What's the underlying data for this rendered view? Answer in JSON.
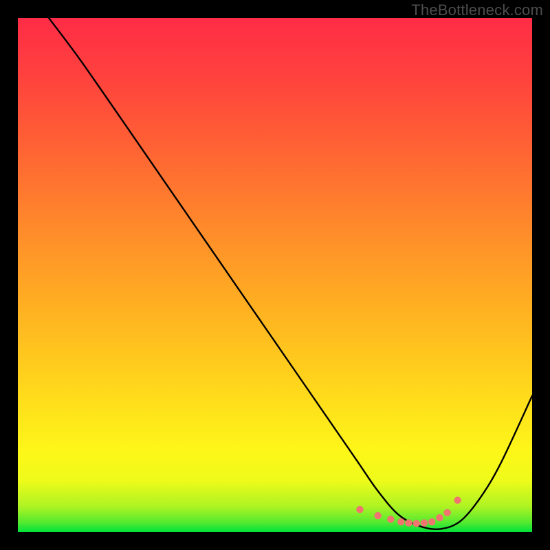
{
  "watermark": "TheBottleneck.com",
  "chart_data": {
    "type": "line",
    "title": "",
    "xlabel": "",
    "ylabel": "",
    "xlim": [
      0,
      100
    ],
    "ylim": [
      0,
      100
    ],
    "grid": false,
    "background_gradient": {
      "stops": [
        {
          "offset": 0.0,
          "color": "#00e23a"
        },
        {
          "offset": 0.02,
          "color": "#58ea2f"
        },
        {
          "offset": 0.05,
          "color": "#aef323"
        },
        {
          "offset": 0.1,
          "color": "#eefb1a"
        },
        {
          "offset": 0.16,
          "color": "#fef619"
        },
        {
          "offset": 0.3,
          "color": "#ffd21c"
        },
        {
          "offset": 0.45,
          "color": "#ffad22"
        },
        {
          "offset": 0.6,
          "color": "#ff882b"
        },
        {
          "offset": 0.75,
          "color": "#ff6234"
        },
        {
          "offset": 0.88,
          "color": "#ff433d"
        },
        {
          "offset": 1.0,
          "color": "#ff2c46"
        }
      ]
    },
    "series": [
      {
        "name": "bottleneck-curve",
        "color": "#000000",
        "x": [
          6,
          12,
          20,
          30,
          40,
          50,
          60,
          66,
          70,
          74,
          78,
          82,
          86,
          90,
          94,
          100
        ],
        "y": [
          100,
          92,
          80.5,
          66,
          51.5,
          37,
          22.5,
          13.8,
          8,
          3.4,
          1.2,
          0.6,
          2.1,
          6.8,
          13.6,
          26.5
        ]
      }
    ],
    "markers": {
      "name": "trough-dots",
      "color": "#f07470",
      "radius": 5.2,
      "x": [
        66.5,
        70,
        72.5,
        74.5,
        76,
        77.5,
        79,
        80.5,
        82,
        83.5,
        85.5
      ],
      "y": [
        4.4,
        3.2,
        2.5,
        2.0,
        1.8,
        1.7,
        1.8,
        2.0,
        2.8,
        3.8,
        6.2
      ]
    }
  }
}
